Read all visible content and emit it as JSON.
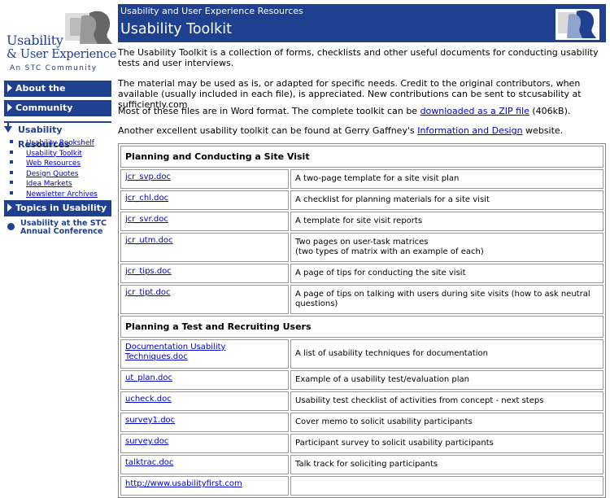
{
  "logo": {
    "line1": "Usability",
    "line2": "& User Experience",
    "line3": "An STC Community"
  },
  "sidebar": {
    "about": "About the Community",
    "community": "Community Activities",
    "resources": "Usability Resources",
    "subitems": [
      "Usability Bookshelf",
      "Usability Toolkit",
      "Web Resources",
      "Design Quotes",
      "Idea Markets",
      "Newsletter Archives"
    ],
    "topics": "Topics in Usability",
    "conference": "Usability at the STC Annual Conference"
  },
  "header": {
    "site": "Usability and User Experience Resources",
    "title": "Usability Toolkit"
  },
  "content": {
    "p1": "The Usability Toolkit is a collection of forms, checklists and other useful documents for conducting usability tests and user interviews.",
    "p2": "The material may be used as is, or adapted for specific needs. Credit to the original contributors, when available (usually included in each file), is appreciated. New contributions can be sent to stcusability at sufficiently.com",
    "p3_pre": "Most of these files are in Word format. The complete toolkit can be ",
    "p3_link": "downloaded as a ZIP file",
    "p3_post": " (406kB).",
    "p4_pre": "Another excellent usability toolkit can be found at Gerry Gaffney's ",
    "p4_link": "Information and Design",
    "p4_post": " website."
  },
  "table": {
    "section1": "Planning and Conducting a Site Visit",
    "rows1": [
      {
        "file": "jcr_svp.doc",
        "desc": "A two-page template for a site visit plan"
      },
      {
        "file": "jcr_chl.doc",
        "desc": "A checklist for planning materials for a site visit"
      },
      {
        "file": "jcr_svr.doc",
        "desc": "A template for site visit reports"
      },
      {
        "file": "jcr_utm.doc",
        "desc": "Two pages on user-task matrices",
        "desc2": "(two types of matrix with an example of each)"
      },
      {
        "file": "jcr_tips.doc",
        "desc": "A page of tips for conducting the site visit"
      },
      {
        "file": "jcr_tipt.doc",
        "desc": "A page of tips on talking with users during site visits (how to ask neutral questions)"
      }
    ],
    "section2": "Planning a Test and Recruiting Users",
    "rows2": [
      {
        "file": "Documentation Usability Techniques.doc",
        "desc": "A list of usability techniques for documentation"
      },
      {
        "file": "ut_plan.doc",
        "desc": "Example of a usability test/evaluation plan"
      },
      {
        "file": "ucheck.doc",
        "desc": "Usability test checklist of activities from concept - next steps"
      },
      {
        "file": "survey1.doc",
        "desc": "Cover memo to solicit usability participants"
      },
      {
        "file": "survey.doc",
        "desc": "Participant survey to solicit usability participants"
      },
      {
        "file": "talktrac.doc",
        "desc": "Talk track for soliciting participants"
      },
      {
        "file": "http://www.usabilityfirst.com",
        "desc": ""
      }
    ]
  }
}
